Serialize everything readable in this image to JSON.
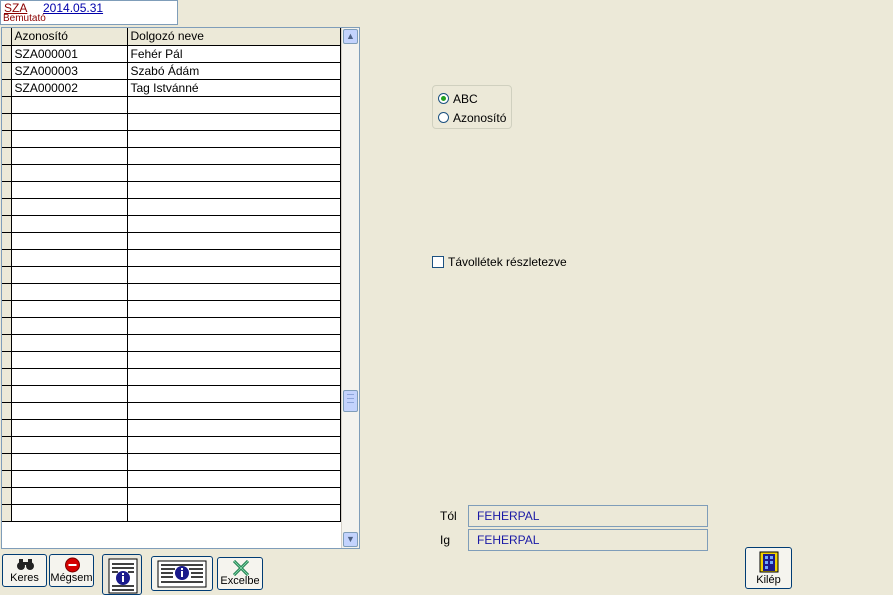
{
  "header": {
    "code": "SZA",
    "date": "2014.05.31",
    "subtitle": "Bemutató"
  },
  "table": {
    "columns": [
      "Azonosító",
      "Dolgozó neve"
    ],
    "rows": [
      [
        "SZA000001",
        "Fehér Pál"
      ],
      [
        "SZA000003",
        "Szabó Ádám"
      ],
      [
        "SZA000002",
        "Tag Istvánné"
      ]
    ],
    "empty_row_count": 25
  },
  "sort": {
    "options": [
      "ABC",
      "Azonosító"
    ],
    "selected": "ABC"
  },
  "absence": {
    "label": "Távollétek részletezve",
    "checked": false
  },
  "range": {
    "from_label": "Tól",
    "from_value": "FEHERPAL",
    "to_label": "Ig",
    "to_value": "FEHERPAL"
  },
  "toolbar": {
    "search_label": "Keres",
    "cancel_label": "Mégsem",
    "excel_label": "Excelbe",
    "exit_label": "Kilép"
  },
  "icons": {
    "search": "binoculars-icon",
    "cancel": "stop-icon",
    "info1": "document-info-icon",
    "info2": "list-info-icon",
    "excel": "excel-x-icon",
    "exit": "exit-door-icon"
  },
  "colors": {
    "background": "#ece9d8",
    "value_text": "#1a1aa6",
    "header_code": "#8b0000"
  }
}
